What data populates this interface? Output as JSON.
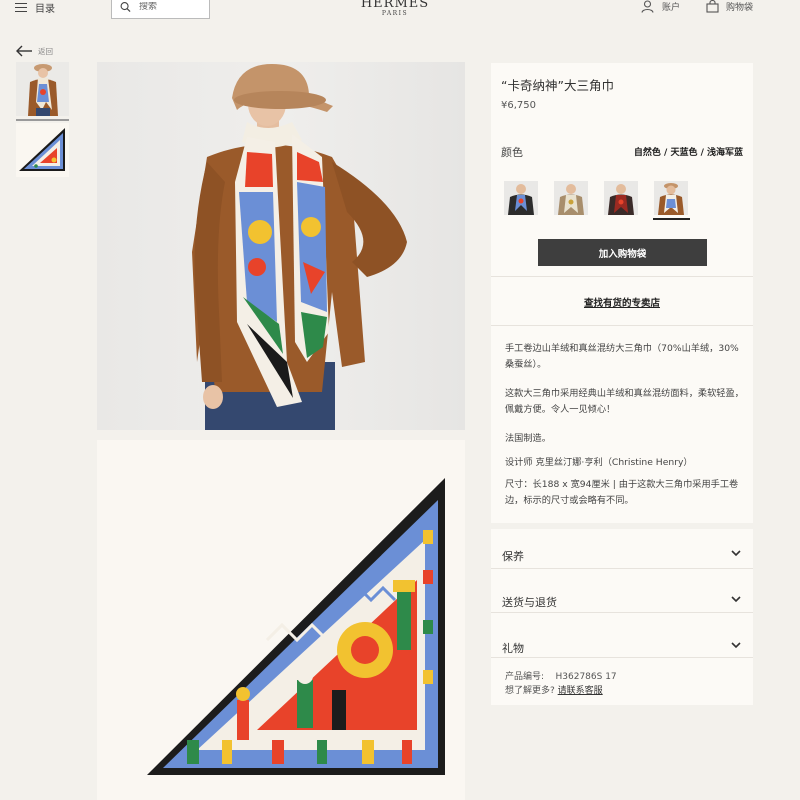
{
  "header": {
    "menu_label": "目录",
    "search_placeholder": "搜索",
    "brand": "HERMÈS",
    "city": "PARIS",
    "account_label": "账户",
    "cart_label": "购物袋"
  },
  "nav": {
    "back_label": "返回"
  },
  "product": {
    "title": "“卡奇纳神”大三角巾",
    "price": "¥6,750",
    "color_label": "颜色",
    "color_value": "自然色 / 天蓝色 / 浅海军蓝",
    "swatch_count": 4,
    "selected_swatch": 4,
    "add_to_cart": "加入购物袋",
    "find_store": "查找有货的专卖店",
    "description": [
      "手工卷边山羊绒和真丝混纺大三角巾（70%山羊绒，30%桑蚕丝）。",
      "这款大三角巾采用经典山羊绒和真丝混纺面料，柔软轻盈，佩戴方便。令人一见倾心！",
      "法国制造。",
      "设计师 克里丝汀娜·亨利（Christine Henry）",
      "尺寸：长188 x 宽94厘米 | 由于这款大三角巾采用手工卷边，标示的尺寸或会略有不同。"
    ]
  },
  "accordion": [
    {
      "label": "保养"
    },
    {
      "label": "送货与退货"
    },
    {
      "label": "礼物"
    }
  ],
  "meta": {
    "product_code_label": "产品编号:",
    "product_code": "H362786S 17",
    "more_question": "想了解更多?",
    "contact_link": "请联系客服"
  },
  "colors": {
    "background": "#f3f1ec",
    "panel": "#fcfaf6",
    "button": "#3e3e3e",
    "scarf_red": "#e8432a",
    "scarf_blue": "#6b8fd6",
    "sweater": "#9a5a2a"
  }
}
